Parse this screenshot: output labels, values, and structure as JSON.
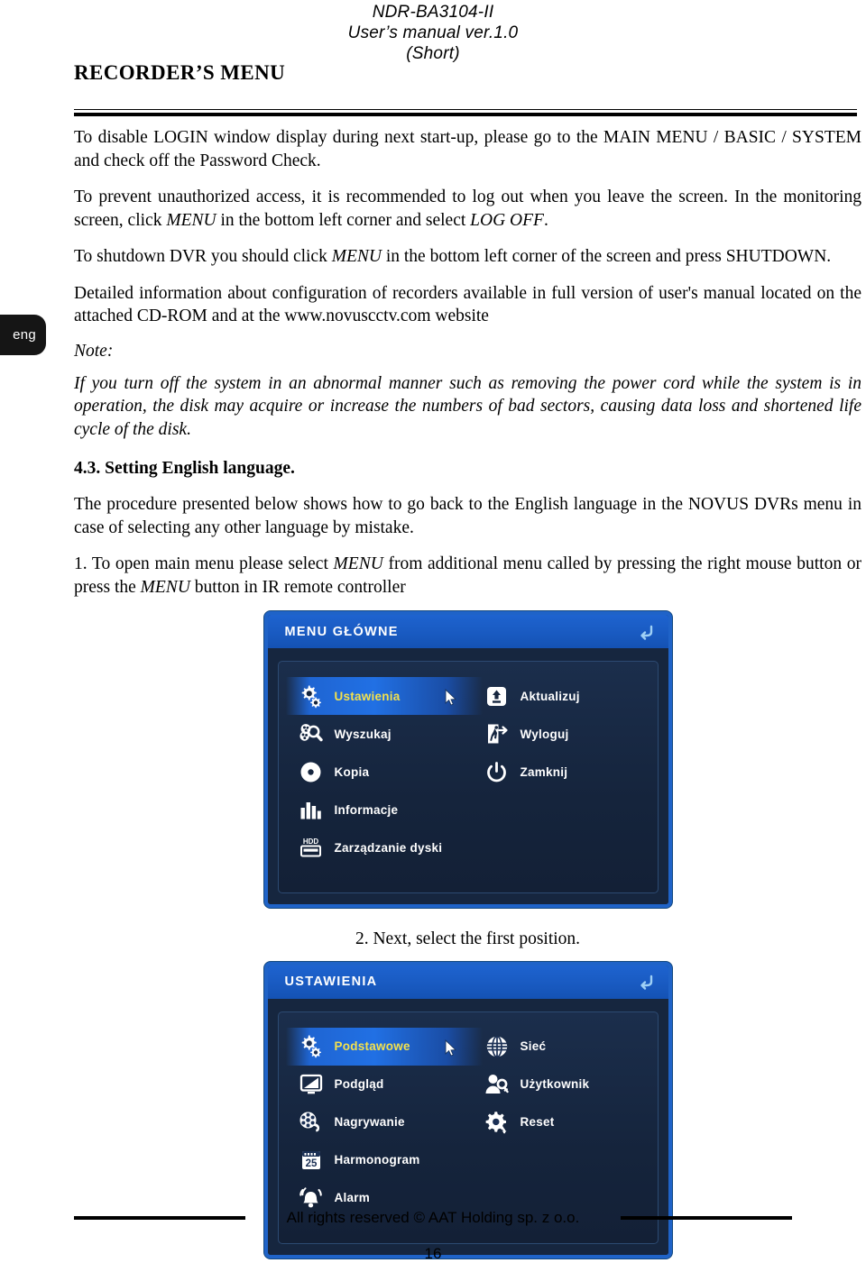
{
  "header": {
    "model": "NDR-BA3104-II",
    "manual_line": "User’s manual ver.1.0",
    "short_note": "(Short)",
    "chapter_title": "RECORDER’S MENU"
  },
  "language_tab": {
    "label": "eng"
  },
  "body": {
    "para1_a": "To disable LOGIN window display during next start-up, please go to the MAIN MENU / BASIC / SYSTEM   and check off the Password Check.",
    "para2_a": "To prevent unauthorized access, it is recommended to log out when you leave the screen. In the monitoring screen, click ",
    "para2_menu": "MENU",
    "para2_b": " in the bottom left corner and select ",
    "para2_logoff": "LOG OFF",
    "para2_c": ".",
    "para3_a": "To shutdown DVR you should click ",
    "para3_menu": "MENU",
    "para3_b": " in the bottom left corner of the screen and press SHUTDOWN.",
    "para4": "Detailed information about configuration of recorders available in full version of user's manual located on the attached CD-ROM and at the www.novuscctv.com website",
    "note_label": "Note:",
    "note_body": "If you turn off the system in an abnormal manner such as removing the power cord while the system is in operation, the disk may acquire or increase the numbers of bad sectors, causing data loss and shortened life cycle of the disk.",
    "section_heading": "4.3. Setting English language.",
    "para5": "The procedure presented below shows how to go back to the English language in the NOVUS DVRs menu in case of selecting any other language by mistake.",
    "step1_a": "1. To open main menu please select ",
    "step1_menu": "MENU",
    "step1_b": " from additional menu called by pressing the right mouse button or press the ",
    "step1_menu2": "MENU",
    "step1_c": " button in IR remote controller",
    "step2": "2. Next, select the first position."
  },
  "screenshot_main_menu": {
    "title": "MENU GŁÓWNE",
    "back_icon": "back-arrow-icon",
    "left_items": [
      {
        "label": "Ustawienia",
        "icon": "gears-icon",
        "selected": true
      },
      {
        "label": "Wyszukaj",
        "icon": "search-film-icon",
        "selected": false
      },
      {
        "label": "Kopia",
        "icon": "disc-icon",
        "selected": false
      },
      {
        "label": "Informacje",
        "icon": "bar-chart-icon",
        "selected": false
      },
      {
        "label": "Zarządzanie dyski",
        "icon": "hdd-icon",
        "selected": false
      }
    ],
    "right_items": [
      {
        "label": "Aktualizuj",
        "icon": "upgrade-usb-icon",
        "selected": false
      },
      {
        "label": "Wyloguj",
        "icon": "logout-door-icon",
        "selected": false
      },
      {
        "label": "Zamknij",
        "icon": "power-icon",
        "selected": false
      }
    ]
  },
  "screenshot_settings": {
    "title": "USTAWIENIA",
    "back_icon": "back-arrow-icon",
    "left_items": [
      {
        "label": "Podstawowe",
        "icon": "gears-icon",
        "selected": true
      },
      {
        "label": "Podgląd",
        "icon": "monitor-icon",
        "selected": false
      },
      {
        "label": "Nagrywanie",
        "icon": "film-reel-icon",
        "selected": false
      },
      {
        "label": "Harmonogram",
        "icon": "calendar-icon",
        "selected": false
      },
      {
        "label": "Alarm",
        "icon": "bell-icon",
        "selected": false
      }
    ],
    "right_items": [
      {
        "label": "Sieć",
        "icon": "globe-icon",
        "selected": false
      },
      {
        "label": "Użytkownik",
        "icon": "user-key-icon",
        "selected": false
      },
      {
        "label": "Reset",
        "icon": "gear-reset-icon",
        "selected": false
      }
    ],
    "calendar_day": "25",
    "hdd_label": "HDD"
  },
  "footer": {
    "copyright": "All rights reserved © AAT Holding sp. z o.o.",
    "page_number": "16"
  },
  "colors": {
    "panel_border": "#1f63c8",
    "titlebar": "#1a5cc4",
    "panel_bg": "#16263f",
    "selected_text": "#f3e14d"
  }
}
